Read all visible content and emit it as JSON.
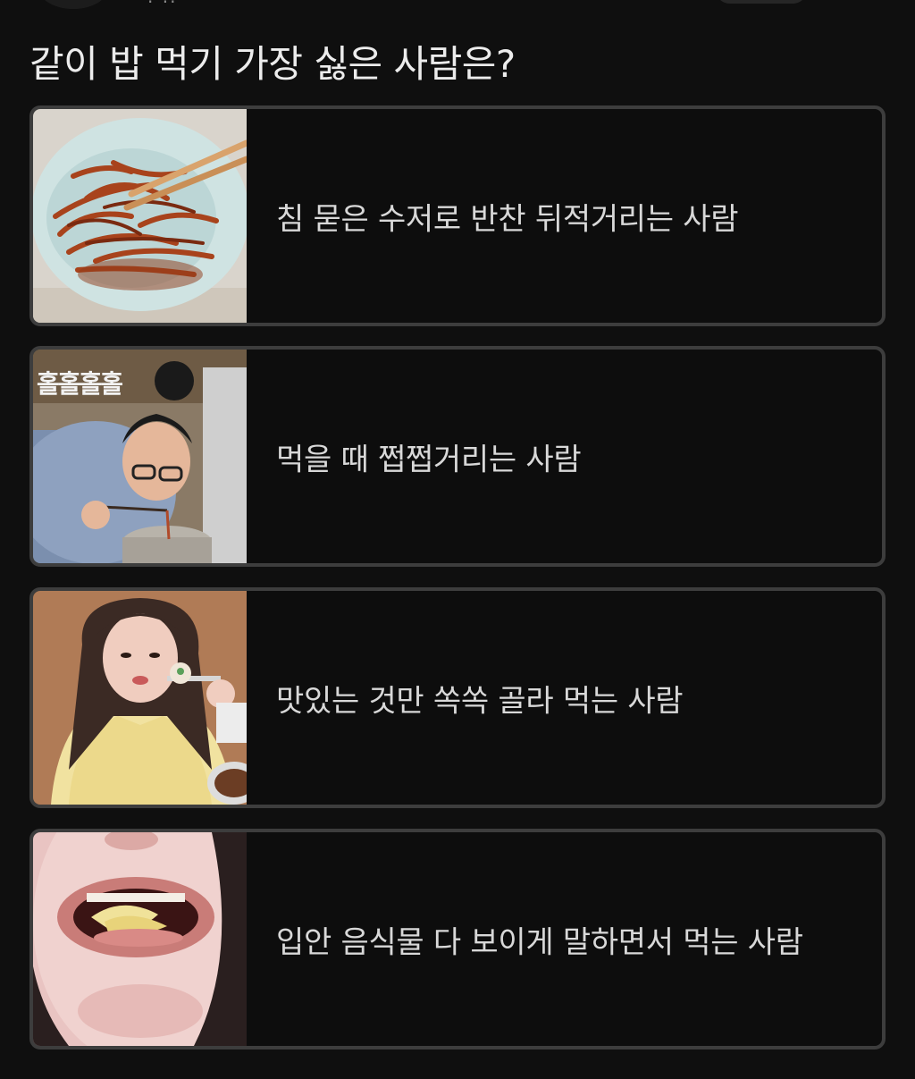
{
  "poll": {
    "title": "같이 밥 먹기 가장 싫은 사람은?",
    "options": [
      {
        "label": "침 묻은 수저로 반찬 뒤적거리는 사람"
      },
      {
        "label": "먹을 때 쩝쩝거리는 사람"
      },
      {
        "label": "맛있는 것만 쏙쏙 골라 먹는 사람"
      },
      {
        "label": "입안 음식물 다 보이게 말하면서 먹는 사람"
      }
    ]
  },
  "thumb_overlay": {
    "text": "홀홀홀홀"
  },
  "colors": {
    "background": "#0f0f0f",
    "option_border": "#3d3d3d",
    "text": "#d8d8d8"
  }
}
